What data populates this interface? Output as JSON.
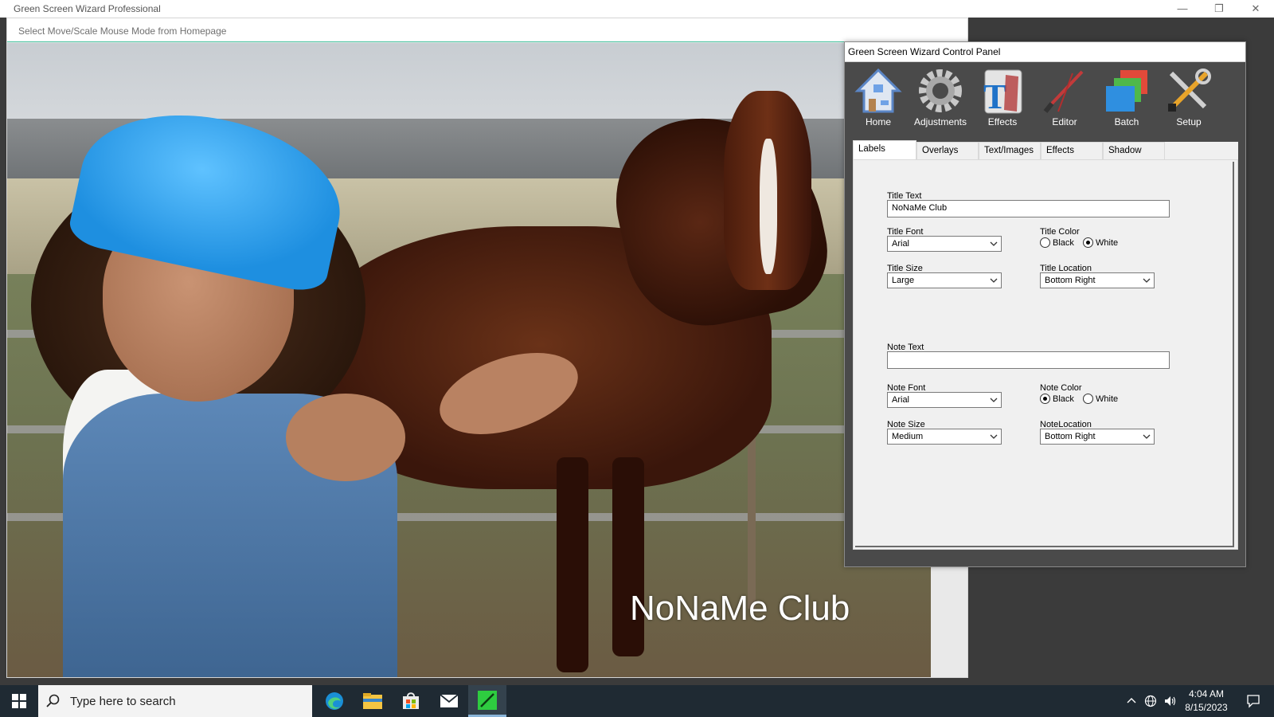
{
  "app": {
    "title": "Green Screen Wizard Professional",
    "hint": "Select Move/Scale Mouse Mode from Homepage",
    "window_buttons": {
      "minimize": "—",
      "restore": "❐",
      "close": "✕"
    }
  },
  "canvas": {
    "overlay_title": "NoNaMe Club"
  },
  "panel": {
    "title": "Green Screen Wizard Control Panel",
    "toolbar": [
      {
        "label": "Home",
        "icon": "home-icon"
      },
      {
        "label": "Adjustments",
        "icon": "gear-icon"
      },
      {
        "label": "Effects",
        "icon": "text-effects-icon"
      },
      {
        "label": "Editor",
        "icon": "brush-icon"
      },
      {
        "label": "Batch",
        "icon": "layers-icon"
      },
      {
        "label": "Setup",
        "icon": "tools-icon"
      }
    ],
    "tabs": [
      {
        "label": "Labels",
        "active": true
      },
      {
        "label": "Overlays",
        "active": false
      },
      {
        "label": "Text/Images",
        "active": false
      },
      {
        "label": "Effects",
        "active": false
      },
      {
        "label": "Shadow",
        "active": false
      }
    ],
    "labels": {
      "title_text_label": "Title Text",
      "title_text_value": "NoNaMe Club",
      "title_font_label": "Title Font",
      "title_font_value": "Arial",
      "title_color_label": "Title Color",
      "title_color_options": [
        "Black",
        "White"
      ],
      "title_color_selected": "White",
      "title_size_label": "Title Size",
      "title_size_value": "Large",
      "title_location_label": "Title Location",
      "title_location_value": "Bottom Right",
      "note_text_label": "Note Text",
      "note_text_value": "",
      "note_font_label": "Note Font",
      "note_font_value": "Arial",
      "note_color_label": "Note Color",
      "note_color_options": [
        "Black",
        "White"
      ],
      "note_color_selected": "Black",
      "note_size_label": "Note Size",
      "note_size_value": "Medium",
      "note_location_label": "NoteLocation",
      "note_location_value": "Bottom Right"
    }
  },
  "taskbar": {
    "search_placeholder": "Type here to search",
    "pinned": [
      "edge-icon",
      "file-explorer-icon",
      "store-icon",
      "mail-icon",
      "green-screen-wizard-icon"
    ],
    "time": "4:04 AM",
    "date": "8/15/2023"
  }
}
